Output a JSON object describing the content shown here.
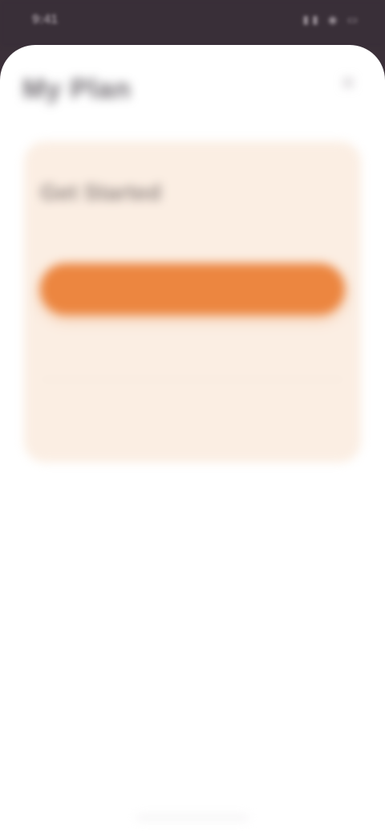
{
  "status_bar": {
    "time": "9:41",
    "icons": "▮▮ ◉ ▭"
  },
  "header": {
    "title": "My Plan",
    "close_icon": "close-icon"
  },
  "card": {
    "title": "Get Started",
    "subtitle": "",
    "primary_button_label": "",
    "secondary_button_label": "",
    "tertiary_button_label": ""
  },
  "colors": {
    "accent": "#ec8640",
    "card_background": "#fbeee3",
    "status_bar": "#392f38"
  }
}
